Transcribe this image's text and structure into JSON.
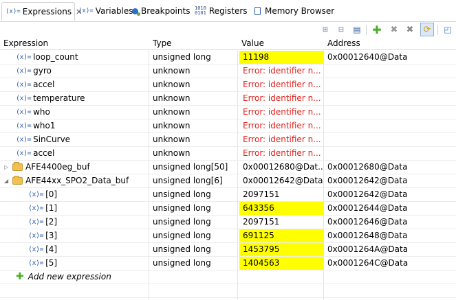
{
  "tabs": [
    {
      "label": "Expressions",
      "icon": "expressions-icon",
      "active": true,
      "closable": true
    },
    {
      "label": "Variables",
      "icon": "variables-icon",
      "active": false
    },
    {
      "label": "Breakpoints",
      "icon": "breakpoints-icon",
      "active": false
    },
    {
      "label": "Registers",
      "icon": "registers-icon",
      "active": false
    },
    {
      "label": "Memory Browser",
      "icon": "memory-icon",
      "active": false
    }
  ],
  "toolbar": {
    "icons": [
      "show-type-names-icon",
      "collapse-all-icon",
      "layout-icon",
      "add-expression-icon",
      "remove-icon",
      "remove-all-icon",
      "continuous-refresh-icon",
      "new-view-icon"
    ]
  },
  "columns": {
    "expression": "Expression",
    "type": "Type",
    "value": "Value",
    "address": "Address"
  },
  "rows": [
    {
      "name": "loop_count",
      "type": "unsigned long",
      "value": "11198",
      "address": "0x00012640@Data",
      "highlight": true,
      "error": false,
      "level": 0,
      "kind": "var"
    },
    {
      "name": "gyro",
      "type": "unknown",
      "value": "Error: identifier n...",
      "address": "",
      "highlight": false,
      "error": true,
      "level": 0,
      "kind": "var"
    },
    {
      "name": "accel",
      "type": "unknown",
      "value": "Error: identifier n...",
      "address": "",
      "highlight": false,
      "error": true,
      "level": 0,
      "kind": "var"
    },
    {
      "name": "temperature",
      "type": "unknown",
      "value": "Error: identifier n...",
      "address": "",
      "highlight": false,
      "error": true,
      "level": 0,
      "kind": "var"
    },
    {
      "name": "who",
      "type": "unknown",
      "value": "Error: identifier n...",
      "address": "",
      "highlight": false,
      "error": true,
      "level": 0,
      "kind": "var"
    },
    {
      "name": "who1",
      "type": "unknown",
      "value": "Error: identifier n...",
      "address": "",
      "highlight": false,
      "error": true,
      "level": 0,
      "kind": "var"
    },
    {
      "name": "SinCurve",
      "type": "unknown",
      "value": "Error: identifier n...",
      "address": "",
      "highlight": false,
      "error": true,
      "level": 0,
      "kind": "var"
    },
    {
      "name": "accel",
      "type": "unknown",
      "value": "Error: identifier n...",
      "address": "",
      "highlight": false,
      "error": true,
      "level": 0,
      "kind": "var"
    },
    {
      "name": "AFE4400eg_buf",
      "type": "unsigned long[50]",
      "value": "0x00012680@Dat...",
      "address": "0x00012680@Data",
      "highlight": false,
      "error": false,
      "level": 0,
      "kind": "array",
      "expanded": false
    },
    {
      "name": "AFE44xx_SPO2_Data_buf",
      "type": "unsigned long[6]",
      "value": "0x00012642@Data",
      "address": "0x00012642@Data",
      "highlight": false,
      "error": false,
      "level": 0,
      "kind": "array",
      "expanded": true
    },
    {
      "name": "[0]",
      "type": "unsigned long",
      "value": "2097151",
      "address": "0x00012642@Data",
      "highlight": false,
      "error": false,
      "level": 1,
      "kind": "var"
    },
    {
      "name": "[1]",
      "type": "unsigned long",
      "value": "643356",
      "address": "0x00012644@Data",
      "highlight": true,
      "error": false,
      "level": 1,
      "kind": "var"
    },
    {
      "name": "[2]",
      "type": "unsigned long",
      "value": "2097151",
      "address": "0x00012646@Data",
      "highlight": false,
      "error": false,
      "level": 1,
      "kind": "var"
    },
    {
      "name": "[3]",
      "type": "unsigned long",
      "value": "691125",
      "address": "0x00012648@Data",
      "highlight": true,
      "error": false,
      "level": 1,
      "kind": "var"
    },
    {
      "name": "[4]",
      "type": "unsigned long",
      "value": "1453795",
      "address": "0x0001264A@Data",
      "highlight": true,
      "error": false,
      "level": 1,
      "kind": "var"
    },
    {
      "name": "[5]",
      "type": "unsigned long",
      "value": "1404563",
      "address": "0x0001264C@Data",
      "highlight": true,
      "error": false,
      "level": 1,
      "kind": "var"
    }
  ],
  "add_new": "Add new expression",
  "colors": {
    "highlight": "#ffff00",
    "error": "#e0201c",
    "accent": "#2a5db0"
  }
}
